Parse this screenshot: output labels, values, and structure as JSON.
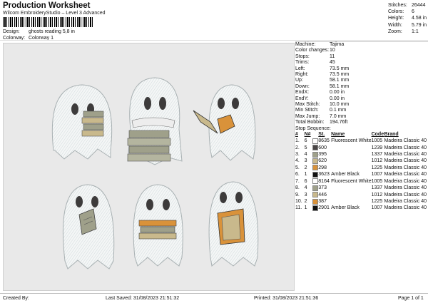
{
  "header": {
    "title": "Production Worksheet",
    "subtitle": "Wilcom EmbroideryStudio – Level 3 Advanced",
    "design_label": "Design:",
    "design_value": "ghosts reading 5,8 in",
    "colorway_label": "Colorway:",
    "colorway_value": "Colorway 1"
  },
  "stats": [
    {
      "label": "Stitches:",
      "value": "26444"
    },
    {
      "label": "Colors:",
      "value": "6"
    },
    {
      "label": "Height:",
      "value": "4.58 in"
    },
    {
      "label": "Width:",
      "value": "5.79 in"
    },
    {
      "label": "Zoom:",
      "value": "1:1"
    }
  ],
  "machine_info": [
    {
      "label": "Machine:",
      "value": "Tajima"
    },
    {
      "label": "Color changes:",
      "value": "10"
    },
    {
      "label": "Stops:",
      "value": "11"
    },
    {
      "label": "Trims:",
      "value": "45"
    },
    {
      "label": "Left:",
      "value": "73.5 mm"
    },
    {
      "label": "Right:",
      "value": "73.5 mm"
    },
    {
      "label": "Up:",
      "value": "58.1 mm"
    },
    {
      "label": "Down:",
      "value": "58.1 mm"
    },
    {
      "label": "EndX:",
      "value": "0.00 in"
    },
    {
      "label": "EndY:",
      "value": "0.00 in"
    },
    {
      "label": "Max Stitch:",
      "value": "10.0 mm"
    },
    {
      "label": "Min Stitch:",
      "value": "0.1 mm"
    },
    {
      "label": "Max Jump:",
      "value": "7.0 mm"
    },
    {
      "label": "Total Bobbin:",
      "value": "194.76ft"
    }
  ],
  "stop_sequence": {
    "label": "Stop Sequence:",
    "headers": [
      "#",
      "N#",
      "",
      "St.",
      "Name",
      "Code",
      "Brand"
    ],
    "rows": [
      {
        "num": "1.",
        "n": "6",
        "color": "#ffffff",
        "st": "8635",
        "name": "Fluorescent White",
        "code": "1005",
        "brand": "Madeira Classic 40"
      },
      {
        "num": "2.",
        "n": "5",
        "color": "#4a4646",
        "st": "600",
        "name": "",
        "code": "1239",
        "brand": "Madeira Classic 40"
      },
      {
        "num": "3.",
        "n": "4",
        "color": "#9fa08a",
        "st": "395",
        "name": "",
        "code": "1337",
        "brand": "Madeira Classic 40"
      },
      {
        "num": "4.",
        "n": "3",
        "color": "#c9b98c",
        "st": "620",
        "name": "",
        "code": "1012",
        "brand": "Madeira Classic 40"
      },
      {
        "num": "5.",
        "n": "2",
        "color": "#d9923a",
        "st": "298",
        "name": "",
        "code": "1225",
        "brand": "Madeira Classic 40"
      },
      {
        "num": "6.",
        "n": "1",
        "color": "#111111",
        "st": "3623",
        "name": "Amber Black",
        "code": "1007",
        "brand": "Madeira Classic 40"
      },
      {
        "num": "7.",
        "n": "6",
        "color": "#ffffff",
        "st": "8164",
        "name": "Fluorescent White",
        "code": "1005",
        "brand": "Madeira Classic 40"
      },
      {
        "num": "8.",
        "n": "4",
        "color": "#9fa08a",
        "st": "373",
        "name": "",
        "code": "1337",
        "brand": "Madeira Classic 40"
      },
      {
        "num": "9.",
        "n": "3",
        "color": "#c9b98c",
        "st": "446",
        "name": "",
        "code": "1012",
        "brand": "Madeira Classic 40"
      },
      {
        "num": "10.",
        "n": "2",
        "color": "#d9923a",
        "st": "387",
        "name": "",
        "code": "1225",
        "brand": "Madeira Classic 40"
      },
      {
        "num": "11.",
        "n": "1",
        "color": "#111111",
        "st": "2901",
        "name": "Amber Black",
        "code": "1007",
        "brand": "Madeira Classic 40"
      }
    ]
  },
  "footer": {
    "created_by": "Created By:",
    "last_saved": "Last Saved: 31/08/2023 21:51:32",
    "printed": "Printed: 31/08/2023 21:51:36",
    "page": "Page 1 of 1"
  }
}
